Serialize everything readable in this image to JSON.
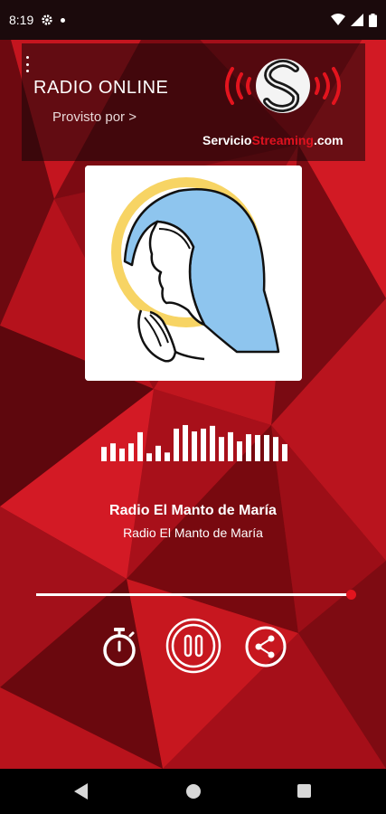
{
  "status_bar": {
    "time": "8:19"
  },
  "header": {
    "title": "RADIO ONLINE",
    "provider_label": "Provisto por >",
    "brand_part1": "Servicio",
    "brand_part2": "Streaming",
    "brand_part3": ".com"
  },
  "player": {
    "station_title": "Radio El Manto de María",
    "station_subtitle": "Radio El Manto de María",
    "volume_fraction": 0.995,
    "equalizer_levels": [
      0.36,
      0.45,
      0.32,
      0.45,
      0.73,
      0.2,
      0.39,
      0.22,
      0.82,
      0.91,
      0.75,
      0.82,
      0.89,
      0.61,
      0.73,
      0.5,
      0.68,
      0.66,
      0.66,
      0.61,
      0.43
    ]
  },
  "colors": {
    "accent": "#e3141e",
    "background": "#b3141d",
    "halo": "#f7d464",
    "veil": "#8ec5ee"
  },
  "icons": {
    "timer": "timer-icon",
    "pause": "pause-icon",
    "share": "share-icon",
    "gear": "gear-icon",
    "signal": "signal-icon",
    "battery": "battery-icon"
  }
}
